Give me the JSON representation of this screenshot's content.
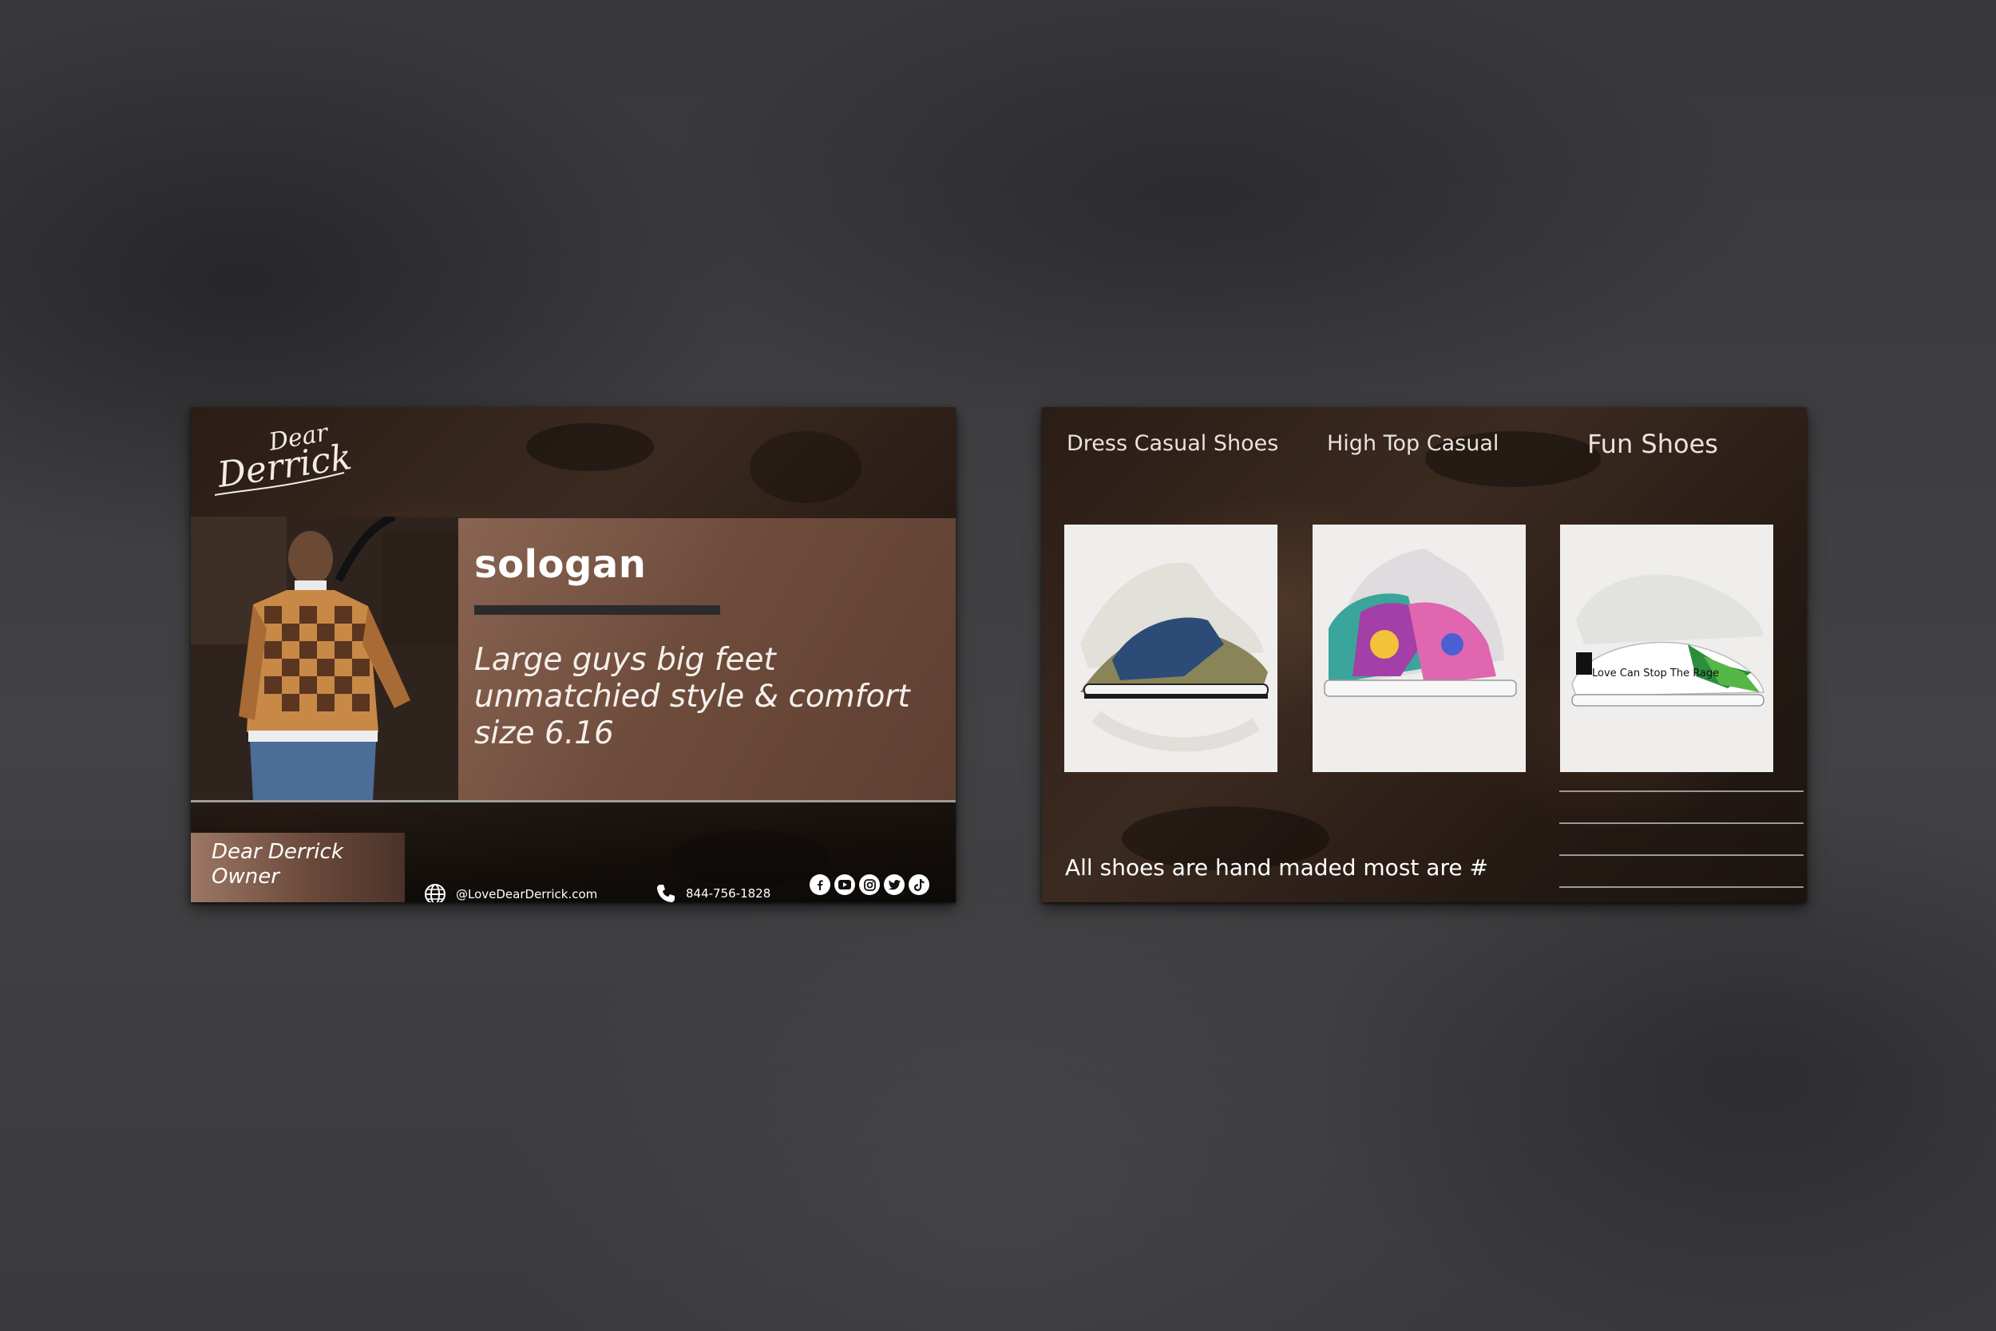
{
  "front": {
    "logo": {
      "line1": "Dear",
      "line2": "Derrick"
    },
    "slogan": {
      "title": "sologan",
      "lines": [
        "Large guys big feet",
        "unmatchied style & comfort",
        "size 6.16"
      ]
    },
    "owner": {
      "name": "Dear Derrick",
      "role": "Owner"
    },
    "website": "@LoveDearDerrick.com",
    "phone": "844-756-1828",
    "social_icons": [
      "facebook-icon",
      "youtube-icon",
      "instagram-icon",
      "twitter-icon",
      "tiktok-icon"
    ]
  },
  "back": {
    "categories": [
      "Dress Casual Shoes",
      "High Top Casual",
      "Fun Shoes"
    ],
    "shoe_text": "Love Can Stop The Rage",
    "footer": "All shoes are hand maded most are #"
  },
  "colors": {
    "card_brown": "#3b2a20",
    "slogan_panel": "#6e4c3c",
    "name_box": "#9c7766",
    "surface": "#3c3c3e"
  }
}
